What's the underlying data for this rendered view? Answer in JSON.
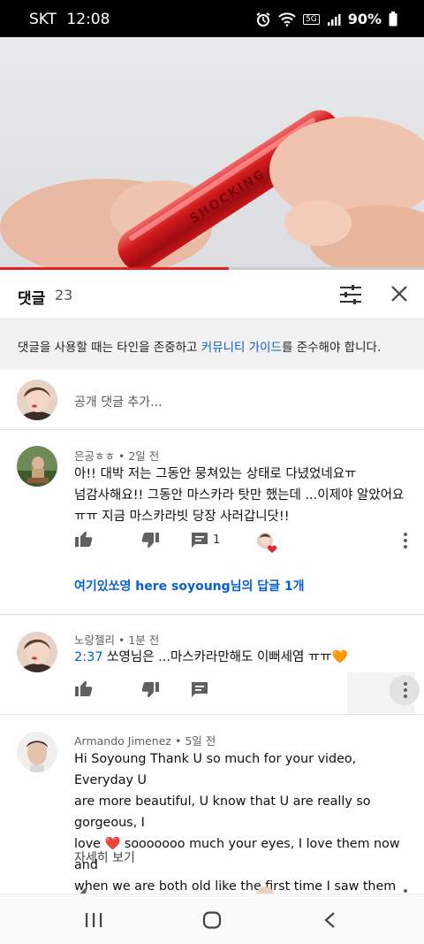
{
  "status_bar": {
    "carrier": "SKT",
    "time": "12:08",
    "network": "5G",
    "battery": "90%"
  },
  "video": {
    "progress_fraction": 0.54
  },
  "comments_panel": {
    "title": "댓글",
    "count": "23",
    "notice_prefix": "댓글을 사용할 때는 타인을 존중하고 ",
    "notice_link": "커뮤니티 가이드",
    "notice_suffix": "를 준수해야 합니다.",
    "add_placeholder": "공개 댓글 추가..."
  },
  "comments": [
    {
      "author": "은공ㅎㅎ",
      "age": "2일 전",
      "lines": [
        "아!! 대박 저는 그동안 뭉쳐있는 상태로 다녔었네요ㅠ",
        "넘감사해요!!  그동안 마스카라 탓만 했는데 ...이제야 알았어요",
        "ㅠㅠ 지금 마스카라빗 당장 사러갑니닷!!"
      ],
      "reply_count": "1",
      "replies_link": "여기있쏘영 here soyoung님의 답글 1개"
    },
    {
      "author": "노랑젤리",
      "age": "1분 전",
      "timestamp": "2:37",
      "text": " 쏘영님은 ...마스카라만해도 이뻐세염 ㅠㅠ🧡"
    },
    {
      "author": "Armando Jimenez",
      "age": "5일 전",
      "lines": [
        "Hi Soyoung Thank U so much for your video, Everyday U",
        "are more beautiful, U know that U are really so gorgeous, I",
        "love ❤️ sooooooo much your eyes, I love them now and",
        "when we are  both old like the first time I saw them",
        "😉❤️🌹."
      ],
      "read_more": "자세히 보기"
    }
  ],
  "meta_separator": " • ",
  "colors": {
    "accent": "#065fd4",
    "progress": "#e52222"
  }
}
